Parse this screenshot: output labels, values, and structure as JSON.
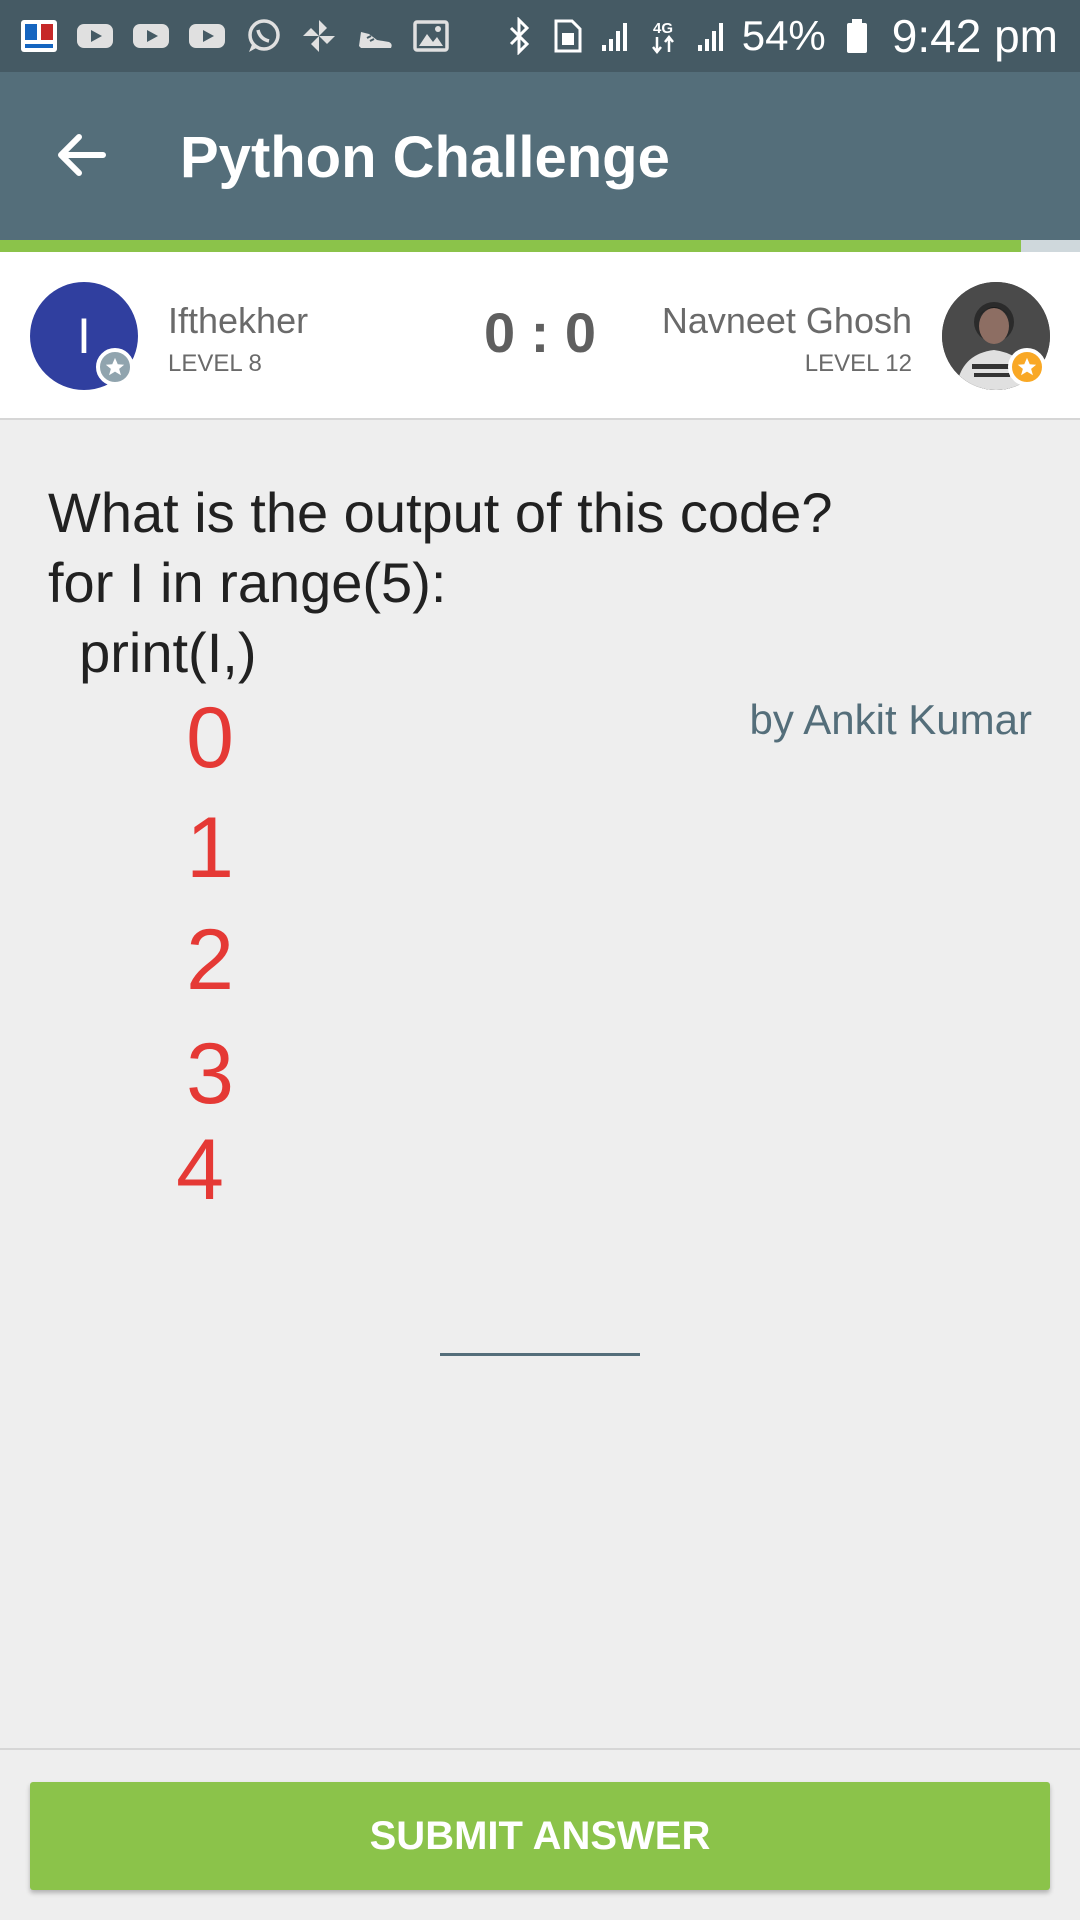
{
  "status_bar": {
    "left_icons": [
      "app-notification-icon",
      "youtube-icon",
      "youtube-icon",
      "youtube-icon",
      "whatsapp-icon",
      "pinwheel-icon",
      "shoe-icon",
      "image-icon"
    ],
    "right_icons": [
      "bluetooth-icon",
      "sim-icon",
      "signal-icon",
      "4g-icon",
      "signal-icon",
      "battery-icon"
    ],
    "battery_percent": "54%",
    "time": "9:42 pm"
  },
  "app_bar": {
    "title": "Python Challenge",
    "progress": 0.945
  },
  "players": {
    "left": {
      "name": "Ifthekher",
      "level": "LEVEL 8",
      "avatar_initial": "I"
    },
    "right": {
      "name": "Navneet Ghosh",
      "level": "LEVEL 12"
    },
    "score": "0 : 0"
  },
  "question": {
    "text": "What is the output of this code?\nfor I in range(5):\n  print(I,)",
    "author": "by Ankit Kumar"
  },
  "code_output": [
    "0",
    "1",
    "2",
    "3",
    "4"
  ],
  "answer": {
    "value": ""
  },
  "submit_label": "SUBMIT ANSWER",
  "colors": {
    "status_bar": "#455a64",
    "app_bar": "#546e7a",
    "accent": "#8bc34a",
    "output_text": "#e53935",
    "author_text": "#546e7a"
  }
}
